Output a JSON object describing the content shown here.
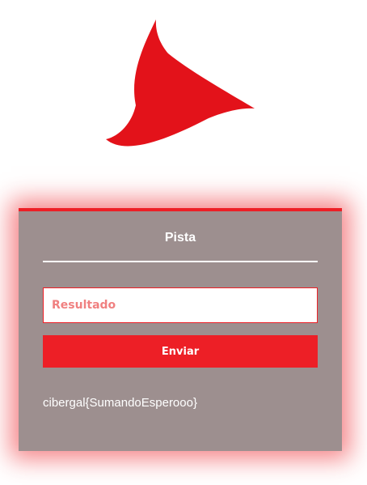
{
  "logo": {
    "icon": "red-flame-logo",
    "color": "#e3121a"
  },
  "card": {
    "title": "Pista",
    "accent_color": "#ed1f26",
    "background_color": "#9d8f8f",
    "input": {
      "placeholder": "Resultado",
      "value": ""
    },
    "submit_label": "Enviar",
    "flag": "cibergal{SumandoEsperooo}"
  }
}
